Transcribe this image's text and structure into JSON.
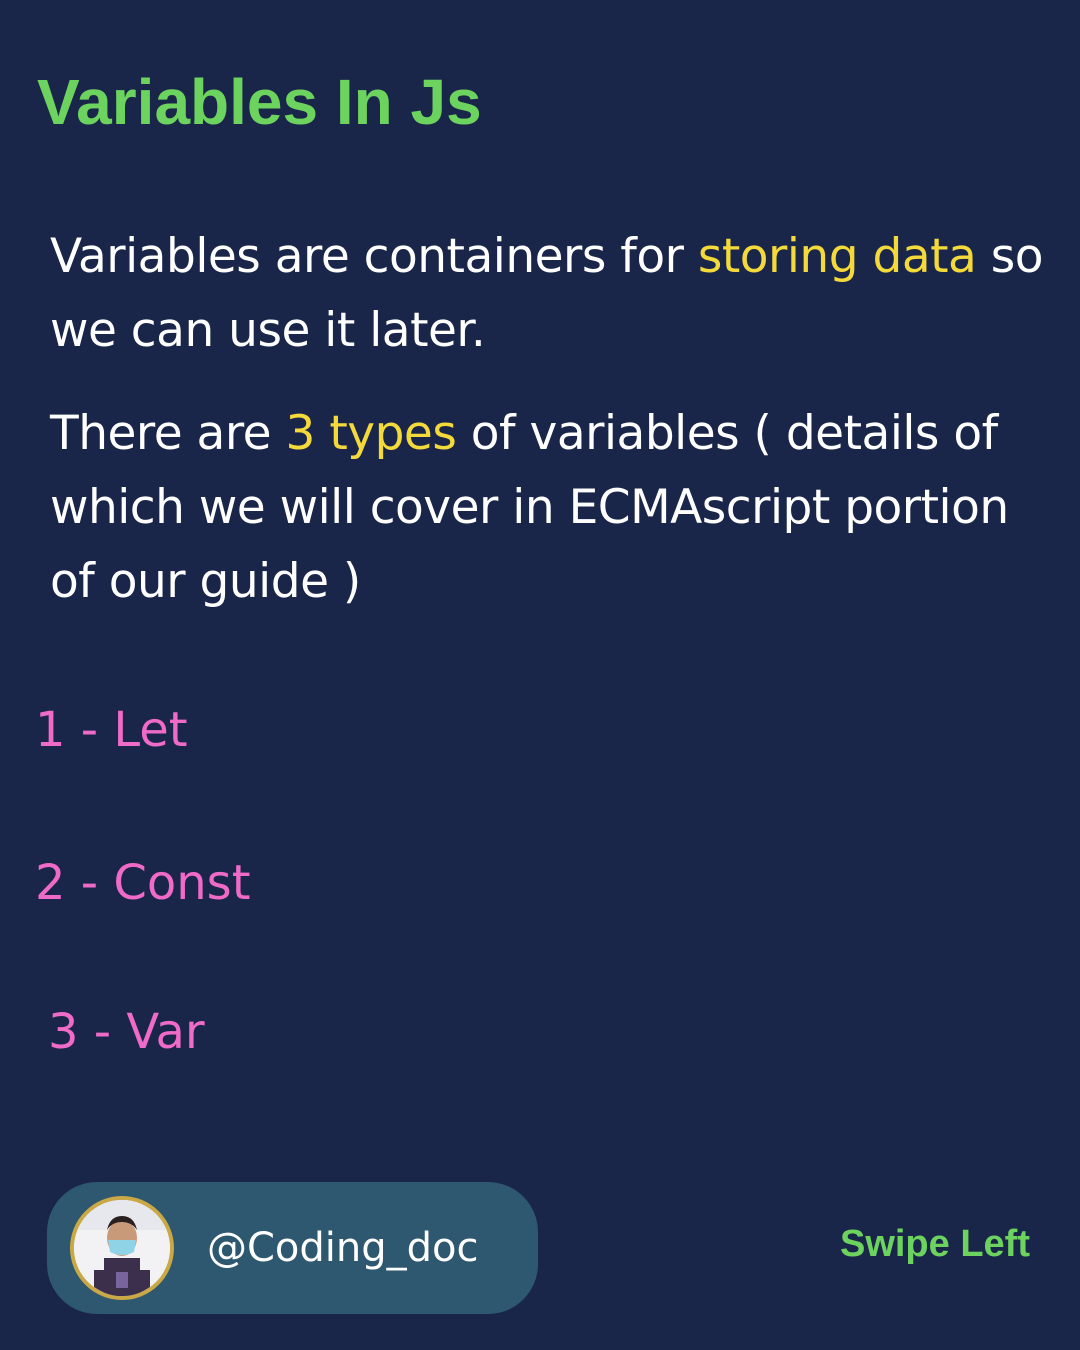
{
  "title": "Variables In Js",
  "para1": {
    "before": "Variables are containers for ",
    "highlight": "storing data",
    "after": " so we can use it later."
  },
  "para2": {
    "before": "There are ",
    "highlight": "3 types",
    "after": " of variables ( details of which we will cover in ECMAscript portion of our guide )"
  },
  "types": [
    "1 - Let",
    "2 - Const",
    "3 - Var"
  ],
  "author": {
    "handle": "@Coding_doc",
    "avatar_icon": "profile-photo-icon"
  },
  "swipe_label": "Swipe Left",
  "colors": {
    "background": "#1a2649",
    "title": "#6dd35f",
    "highlight": "#f4d93b",
    "list": "#f06ac8",
    "pill": "#2e5770"
  }
}
